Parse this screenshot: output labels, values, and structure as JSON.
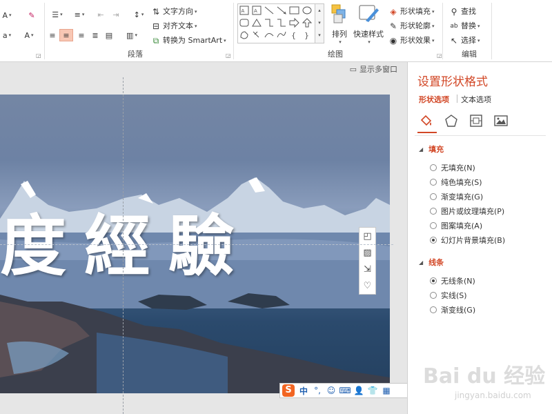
{
  "ribbon": {
    "font_group": {
      "font_grow_glyph": "A",
      "font_shrink_glyph": "A",
      "clear_format_icon": "eraser-icon",
      "char_spacing_glyph": "a",
      "font_color_glyph": "A"
    },
    "paragraph": {
      "label": "段落",
      "text_direction": "文字方向",
      "align_text": "对齐文本",
      "convert_smartart": "转换为 SmartArt"
    },
    "drawing": {
      "label": "绘图",
      "arrange": "排列",
      "quick_styles": "快速样式",
      "shape_fill": "形状填充",
      "shape_outline": "形状轮廓",
      "shape_effects": "形状效果"
    },
    "editing": {
      "label": "编辑",
      "find": "查找",
      "replace": "替换",
      "select": "选择"
    }
  },
  "canvas": {
    "show_multiple_windows": "显示多窗口",
    "slide_title": "度經驗",
    "float_tools": [
      "shape-style-icon",
      "image-icon",
      "crop-icon",
      "heart-icon"
    ]
  },
  "ime": {
    "logo": "S",
    "items": [
      "中",
      "°,",
      "☺",
      "⌨",
      "👤",
      "👕",
      "▦"
    ]
  },
  "pane": {
    "title": "设置形状格式",
    "tabs": [
      "形状选项",
      "文本选项"
    ],
    "icons": [
      "fill-line-icon",
      "effects-pentagon-icon",
      "size-properties-icon",
      "picture-icon"
    ],
    "fill": {
      "label": "填充",
      "options": [
        "无填充(N)",
        "纯色填充(S)",
        "渐变填充(G)",
        "图片或纹理填充(P)",
        "图案填充(A)",
        "幻灯片背景填充(B)"
      ],
      "selected": 5
    },
    "line": {
      "label": "线条",
      "options": [
        "无线条(N)",
        "实线(S)",
        "渐变线(G)"
      ],
      "selected": 0
    }
  },
  "watermark": {
    "main": "Bai du 经验",
    "sub": "jingyan.baidu.com"
  },
  "colors": {
    "accent": "#d24726",
    "active_button": "#f8c7b4"
  }
}
